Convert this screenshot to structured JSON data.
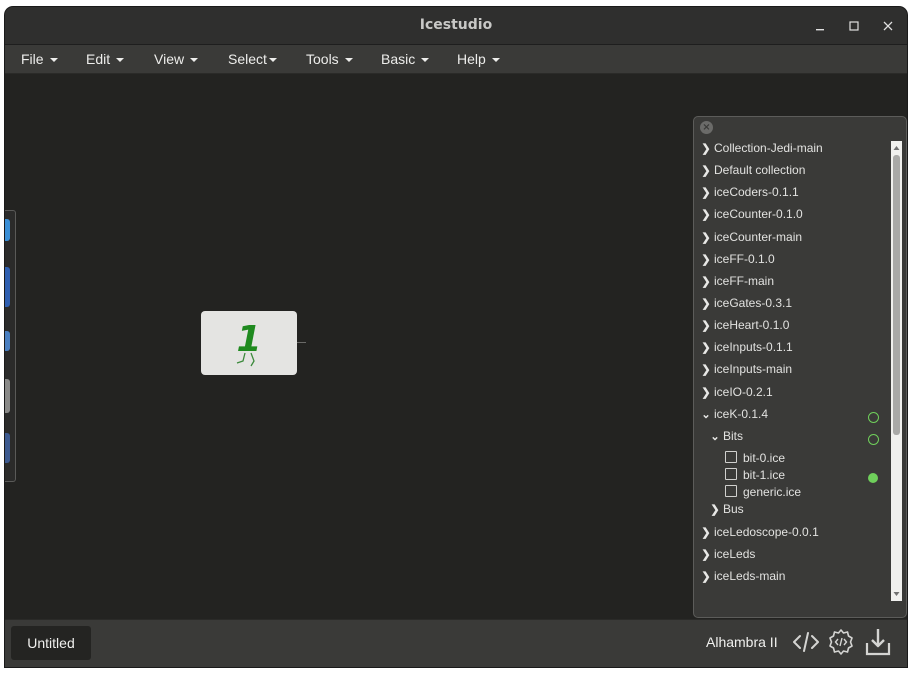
{
  "window": {
    "title": "Icestudio"
  },
  "menubar": {
    "items": [
      "File",
      "Edit",
      "View",
      "Select",
      "Tools",
      "Basic",
      "Help"
    ]
  },
  "block": {
    "label": "1"
  },
  "collections": {
    "items": [
      {
        "label": "Collection-Jedi-main",
        "state": "collapsed"
      },
      {
        "label": "Default collection",
        "state": "collapsed"
      },
      {
        "label": "iceCoders-0.1.1",
        "state": "collapsed"
      },
      {
        "label": "iceCounter-0.1.0",
        "state": "collapsed"
      },
      {
        "label": "iceCounter-main",
        "state": "collapsed"
      },
      {
        "label": "iceFF-0.1.0",
        "state": "collapsed"
      },
      {
        "label": "iceFF-main",
        "state": "collapsed"
      },
      {
        "label": "iceGates-0.3.1",
        "state": "collapsed"
      },
      {
        "label": "iceHeart-0.1.0",
        "state": "collapsed"
      },
      {
        "label": "iceInputs-0.1.1",
        "state": "collapsed"
      },
      {
        "label": "iceInputs-main",
        "state": "collapsed"
      },
      {
        "label": "iceIO-0.2.1",
        "state": "collapsed"
      },
      {
        "label": "iceK-0.1.4",
        "state": "expanded",
        "indicator": "outline"
      },
      {
        "label": "Bits",
        "state": "expanded",
        "indicator": "outline"
      },
      {
        "label": "bit-0.ice",
        "state": "file"
      },
      {
        "label": "bit-1.ice",
        "state": "file",
        "indicator": "filled"
      },
      {
        "label": "generic.ice",
        "state": "file"
      },
      {
        "label": "Bus",
        "state": "collapsed"
      },
      {
        "label": "iceLedoscope-0.0.1",
        "state": "collapsed"
      },
      {
        "label": "iceLeds",
        "state": "collapsed"
      },
      {
        "label": "iceLeds-main",
        "state": "collapsed"
      }
    ]
  },
  "footer": {
    "tab": "Untitled",
    "board": "Alhambra II"
  },
  "colors": {
    "accent_green": "#6fcf5b",
    "block_digit": "#1f8a1f",
    "background": "#232321"
  }
}
